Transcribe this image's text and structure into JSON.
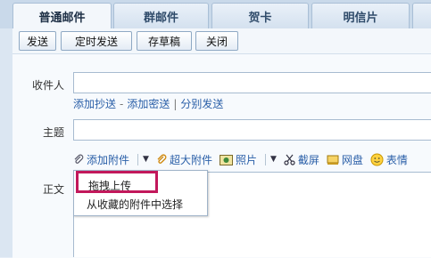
{
  "tabs": [
    {
      "label": "普通邮件",
      "active": true
    },
    {
      "label": "群邮件",
      "active": false
    },
    {
      "label": "贺卡",
      "active": false
    },
    {
      "label": "明信片",
      "active": false
    },
    {
      "label": "",
      "active": false
    }
  ],
  "toolbar": {
    "send": "发送",
    "scheduled_send": "定时发送",
    "save_draft": "存草稿",
    "close": "关闭"
  },
  "form": {
    "recipient_label": "收件人",
    "recipient_value": "",
    "cc_link": "添加抄送",
    "bcc_link": "添加密送",
    "separate_send_link": "分别发送",
    "subject_label": "主题",
    "subject_value": "",
    "body_label": "正文"
  },
  "attach_bar": {
    "attachment": "添加附件",
    "large_attachment": "超大附件",
    "photo": "照片",
    "screenshot": "截屏",
    "netdisk": "网盘",
    "emoticon": "表情"
  },
  "attach_menu": {
    "items": [
      "拖拽上传",
      "从收藏的附件中选择"
    ],
    "highlighted_index": 0
  },
  "colors": {
    "accent_link": "#2a5fa8",
    "highlight_box": "#c2185b",
    "tab_bg": "#d4e1ef"
  }
}
